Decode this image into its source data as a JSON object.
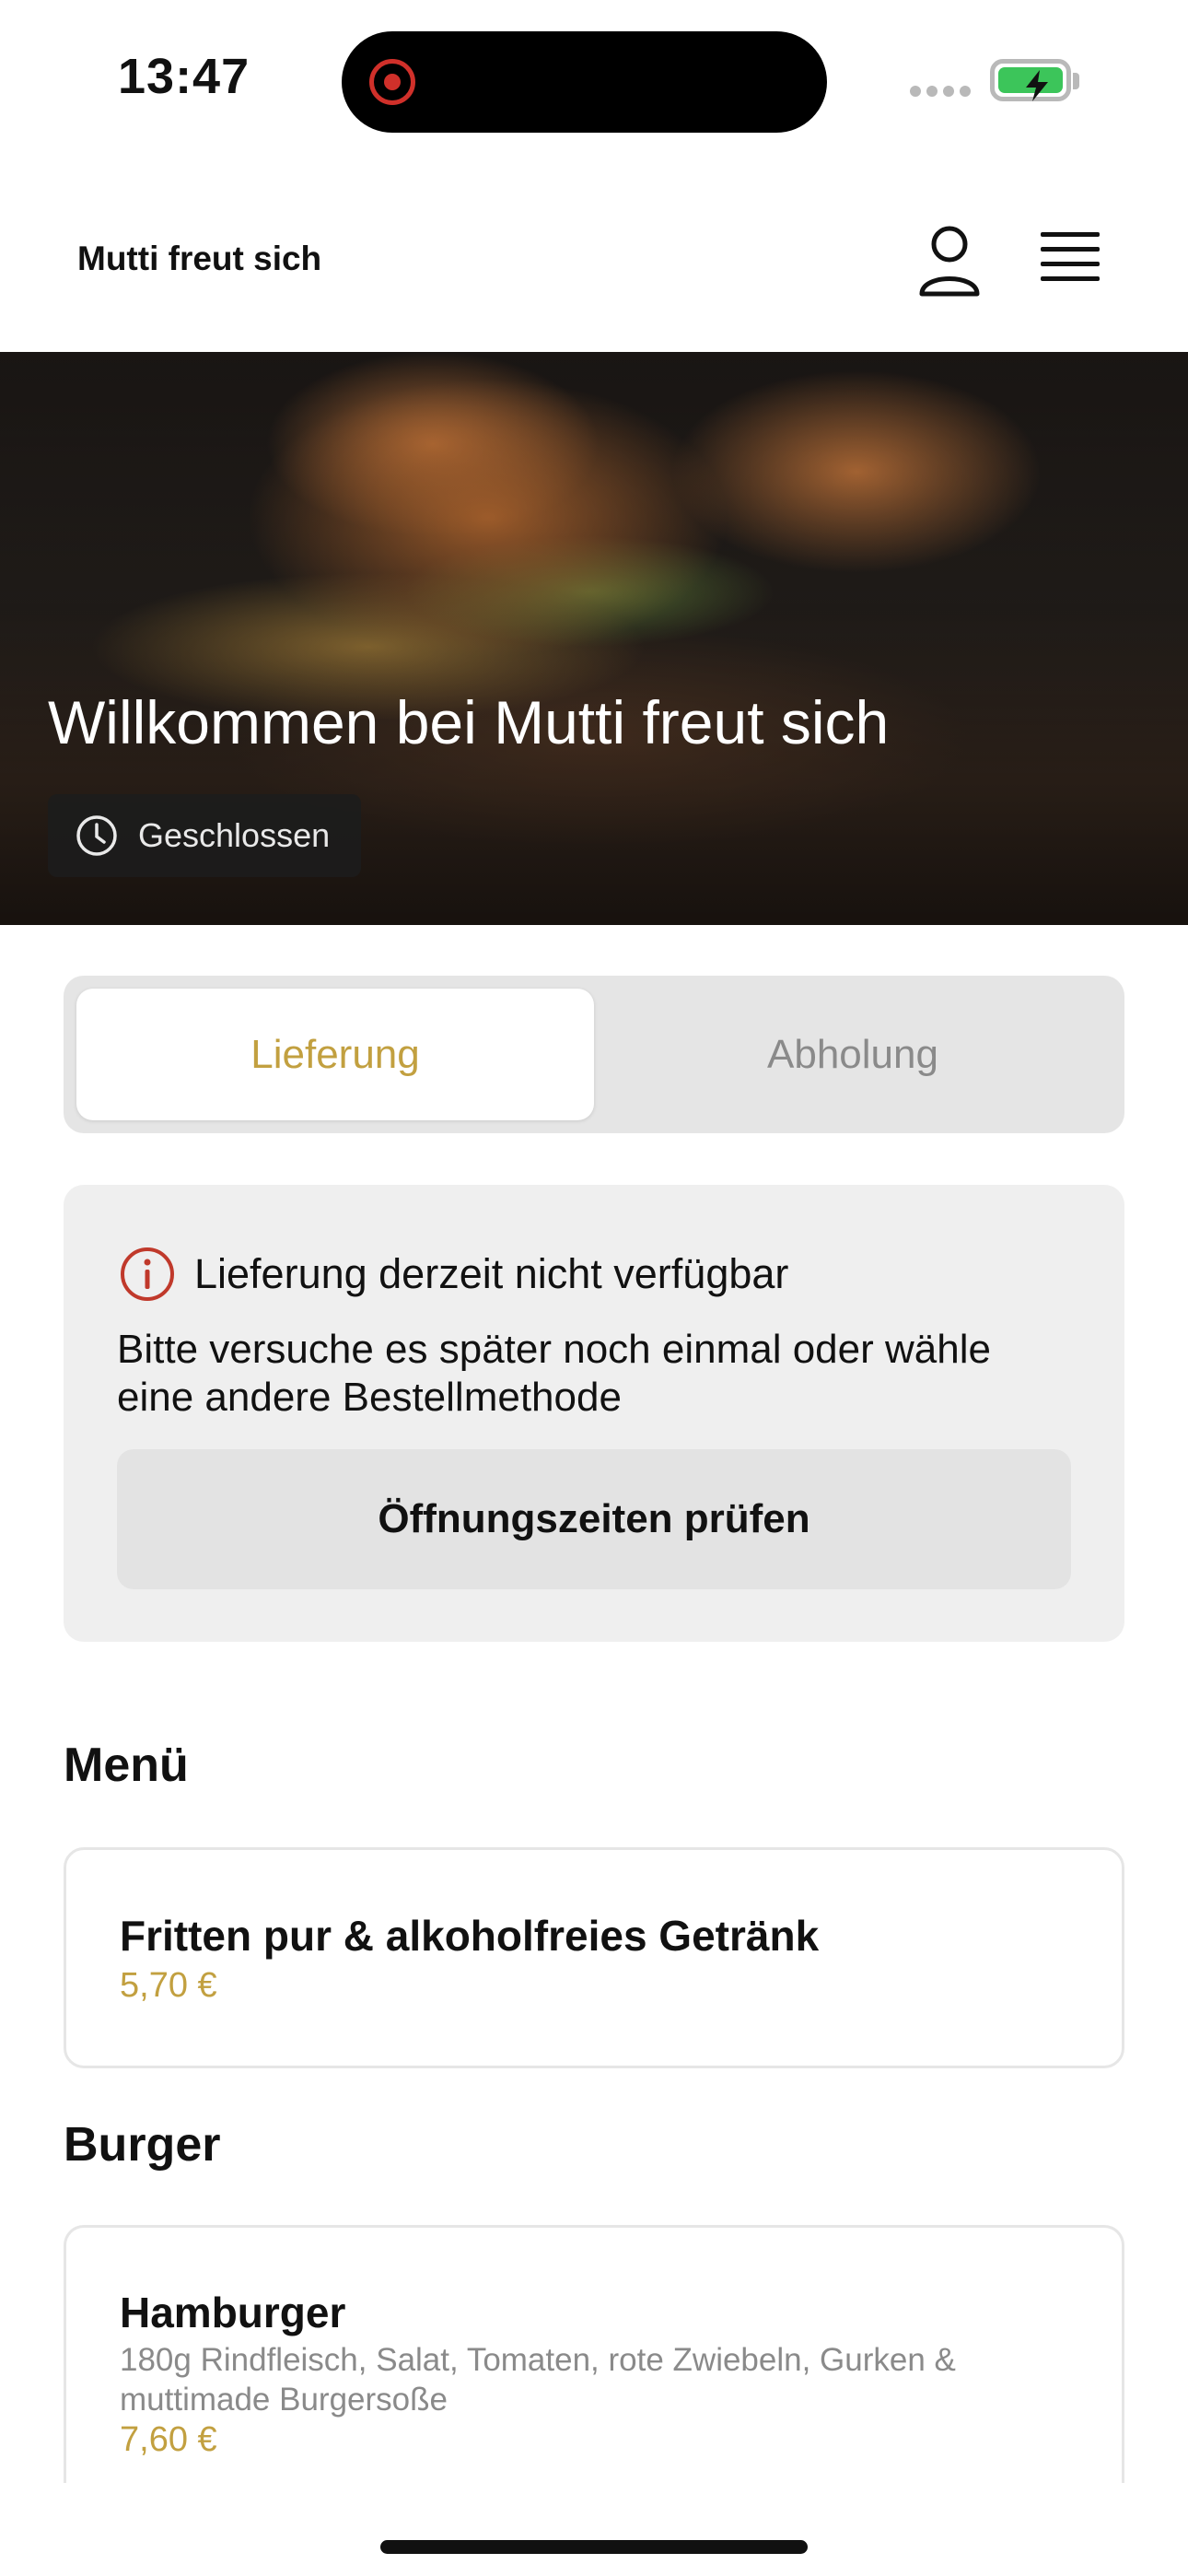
{
  "status_bar": {
    "time": "13:47",
    "battery_color": "#3cc55a",
    "recording_color": "#d0302a"
  },
  "header": {
    "brand": "Mutti freut sich",
    "user_icon": "user-icon",
    "menu_icon": "hamburger-menu-icon"
  },
  "hero": {
    "title": "Willkommen bei Mutti freut sich",
    "status": "Geschlossen",
    "status_icon": "clock-icon"
  },
  "order_method": {
    "options": [
      "Lieferung",
      "Abholung"
    ],
    "selected": "Lieferung",
    "accent": "#c2a040"
  },
  "notice": {
    "icon": "info-icon",
    "title": "Lieferung derzeit nicht verfügbar",
    "body": "Bitte versuche es später noch einmal oder wähle eine andere Bestellmethode",
    "button": "Öffnungszeiten prüfen"
  },
  "menu": {
    "sections": [
      {
        "title": "Menü",
        "items": [
          {
            "name": "Fritten pur & alkoholfreies Getränk",
            "price": "5,70 €"
          }
        ]
      },
      {
        "title": "Burger",
        "items": [
          {
            "name": "Hamburger",
            "description": "180g Rindfleisch, Salat, Tomaten, rote Zwiebeln, Gurken & muttimade Burgersoße",
            "price": "7,60 €"
          }
        ]
      }
    ]
  }
}
